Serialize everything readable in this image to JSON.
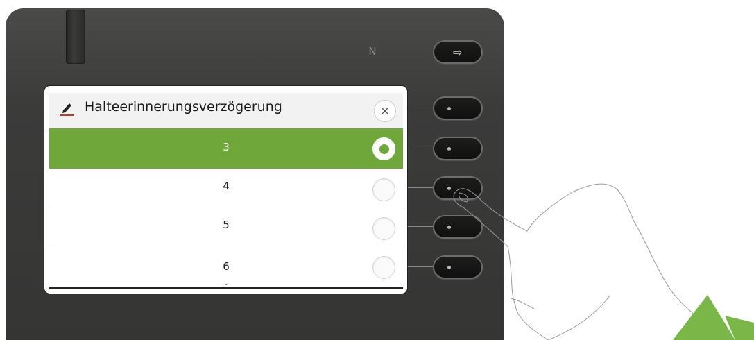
{
  "device": {
    "nfc_symbol": "N",
    "top_button_icon": "exit-icon"
  },
  "dialog": {
    "title": "Halteerinnerungsverzögerung",
    "title_icon": "pencil-icon",
    "close_symbol": "×",
    "accent_color": "#6fa73b",
    "options": [
      {
        "label": "3",
        "selected": true
      },
      {
        "label": "4",
        "selected": false
      },
      {
        "label": "5",
        "selected": false
      },
      {
        "label": "6",
        "selected": false
      }
    ],
    "more_indicator": "⌄"
  }
}
